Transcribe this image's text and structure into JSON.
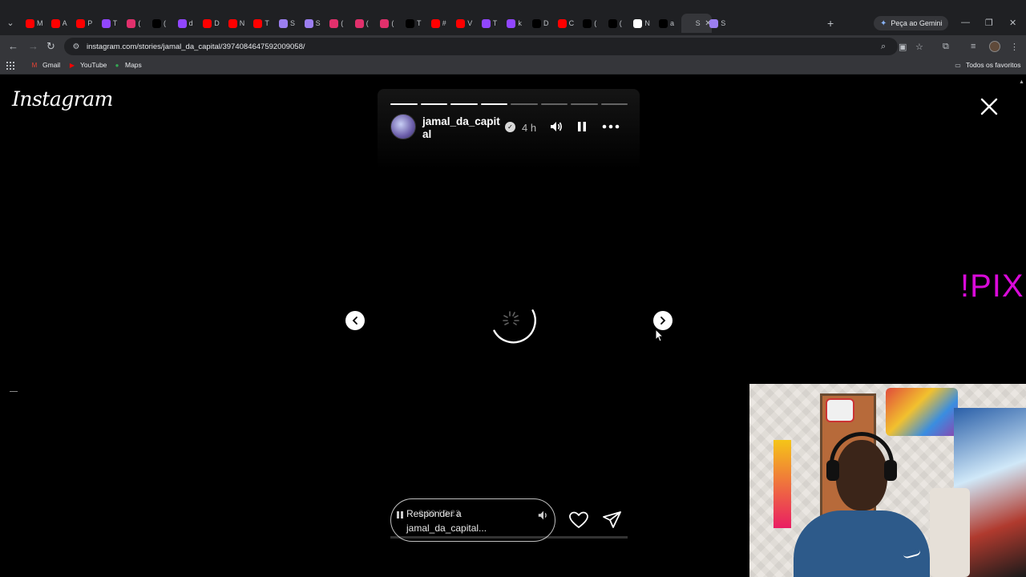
{
  "browser": {
    "tabs": [
      {
        "icon": "youtube-icon",
        "color": "#ff0000",
        "title": "M"
      },
      {
        "icon": "youtube-icon",
        "color": "#ff0000",
        "title": "A"
      },
      {
        "icon": "youtube-icon",
        "color": "#ff0000",
        "title": "P"
      },
      {
        "icon": "twitch-icon",
        "color": "#9146ff",
        "title": "T"
      },
      {
        "icon": "instagram-icon",
        "color": "#e1306c",
        "title": "("
      },
      {
        "icon": "x-icon",
        "color": "#000000",
        "title": "("
      },
      {
        "icon": "twitch-icon",
        "color": "#9146ff",
        "title": "d"
      },
      {
        "icon": "youtube-icon",
        "color": "#ff0000",
        "title": "D"
      },
      {
        "icon": "youtube-icon",
        "color": "#ff0000",
        "title": "N"
      },
      {
        "icon": "youtube-icon",
        "color": "#ff0000",
        "title": "T"
      },
      {
        "icon": "feather-icon",
        "color": "#9b7ef0",
        "title": "S"
      },
      {
        "icon": "feather-icon",
        "color": "#9b7ef0",
        "title": "S"
      },
      {
        "icon": "instagram-icon",
        "color": "#e1306c",
        "title": "("
      },
      {
        "icon": "instagram-icon",
        "color": "#e1306c",
        "title": "("
      },
      {
        "icon": "instagram-icon",
        "color": "#e1306c",
        "title": "("
      },
      {
        "icon": "tiktok-icon",
        "color": "#000000",
        "title": "T"
      },
      {
        "icon": "youtube-icon",
        "color": "#ff0000",
        "title": "#"
      },
      {
        "icon": "youtube-icon",
        "color": "#ff0000",
        "title": "V"
      },
      {
        "icon": "twitch-icon",
        "color": "#9146ff",
        "title": "T"
      },
      {
        "icon": "twitch-icon",
        "color": "#9146ff",
        "title": "k"
      },
      {
        "icon": "tiktok-icon",
        "color": "#000000",
        "title": "D"
      },
      {
        "icon": "youtube-icon",
        "color": "#ff0000",
        "title": "C"
      },
      {
        "icon": "tiktok-icon",
        "color": "#000000",
        "title": "("
      },
      {
        "icon": "tiktok-icon",
        "color": "#000000",
        "title": "("
      },
      {
        "icon": "notion-icon",
        "color": "#ffffff",
        "title": "N"
      },
      {
        "icon": "tiktok-icon",
        "color": "#000000",
        "title": "a"
      },
      {
        "icon": "generic-icon",
        "color": "#35363a",
        "title": "S",
        "active": true
      },
      {
        "icon": "feather-icon",
        "color": "#9b7ef0",
        "title": "S"
      }
    ],
    "gemini_label": "Peça ao Gemini",
    "url": "instagram.com/stories/jamal_da_capital/3974084647592009058/",
    "bookmarks": [
      {
        "icon": "gmail-icon",
        "label": "Gmail"
      },
      {
        "icon": "youtube-icon",
        "label": "YouTube"
      },
      {
        "icon": "maps-icon",
        "label": "Maps"
      }
    ],
    "all_bookmarks_label": "Todos os favoritos"
  },
  "page": {
    "logo_text": "Instagram",
    "overlay_text": "!PIX",
    "story": {
      "username": "jamal_da_capital",
      "time": "4 h",
      "progress_segments": 8,
      "progress_done": 4,
      "reply_line1": "Responder a",
      "reply_line2": "jamal_da_capital...",
      "ghost_text": "0:00 / 0:23",
      "video_progress": 0.0
    }
  }
}
